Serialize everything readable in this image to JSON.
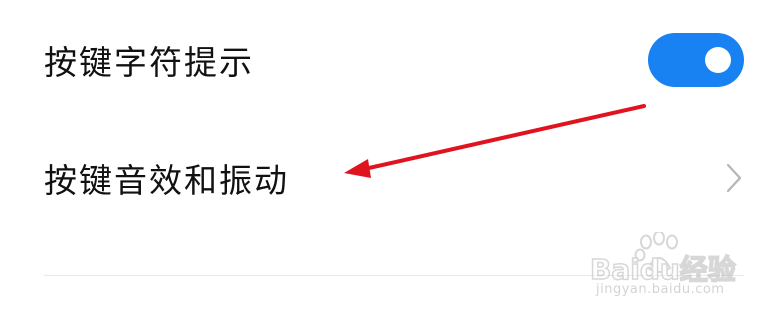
{
  "settings": {
    "items": [
      {
        "label": "按键字符提示",
        "control": "toggle",
        "toggle_on": true
      },
      {
        "label": "按键音效和振动",
        "control": "chevron-right-icon"
      }
    ]
  },
  "colors": {
    "toggle_on": "#1882f2",
    "annotation_arrow": "#e0141e",
    "label_text": "#111111"
  },
  "watermark": {
    "brand": "Baidu经验",
    "url": "jingyan.baidu.com"
  }
}
